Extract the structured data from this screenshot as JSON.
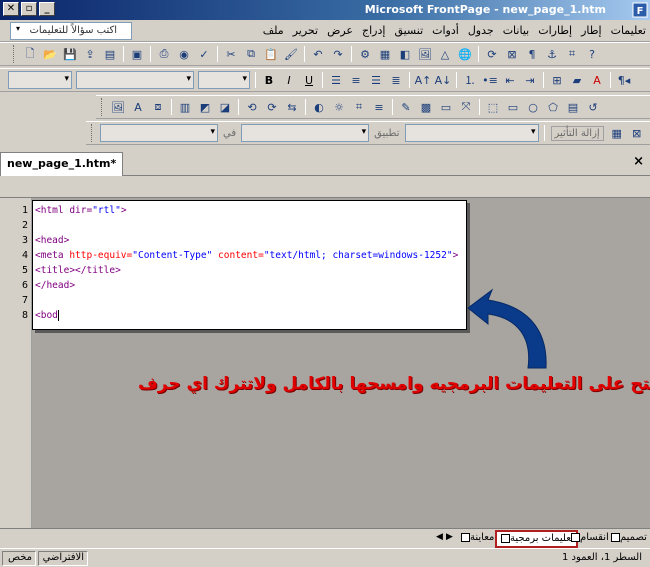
{
  "window": {
    "title": "Microsoft FrontPage - new_page_1.htm",
    "minimize": "_",
    "restore": "▫",
    "close": "✕"
  },
  "menu": {
    "items": [
      "ملف",
      "تحرير",
      "عرض",
      "إدراج",
      "تنسيق",
      "أدوات",
      "جدول",
      "بيانات",
      "إطارات",
      "إطار",
      "تعليمات"
    ],
    "help_placeholder": "اكتب سؤالاً للتعليمات"
  },
  "toolbar3": {
    "apply_label": "تطبيق",
    "in_label": "في",
    "remove_effect": "إزالة التأثير"
  },
  "document": {
    "tab_label": "new_page_1.htm*",
    "tab_close": "×"
  },
  "code": {
    "line_numbers": [
      "1",
      "2",
      "3",
      "4",
      "5",
      "6",
      "7",
      "8"
    ],
    "lines": {
      "l1_tag": "<html dir=",
      "l1_val": "\"rtl\"",
      "l1_end": ">",
      "l3": "<head>",
      "l4_tag": "<meta ",
      "l4_attr1": "http-equiv=",
      "l4_val1": "\"Content-Type\"",
      "l4_attr2": " content=",
      "l4_val2": "\"text/html; charset=windows-1252\"",
      "l4_end": ">",
      "l5": "<title></title>",
      "l6": "</head>",
      "l8": "<bod"
    }
  },
  "annotation": {
    "text": "افتح على التعليمات البرمجيه وامسحها بالكامل ولاتترك اي حرف"
  },
  "view_tabs": {
    "design": "تصميم",
    "split": "انقسام",
    "code": "تعليمات برمجية",
    "preview": "معاينة"
  },
  "status": {
    "position": "السطر 1، العمود 1",
    "default": "الافتراضي",
    "custom": "مخص"
  },
  "colors": {
    "accent_red": "#e00000",
    "arrow_blue": "#0a3a8a"
  }
}
